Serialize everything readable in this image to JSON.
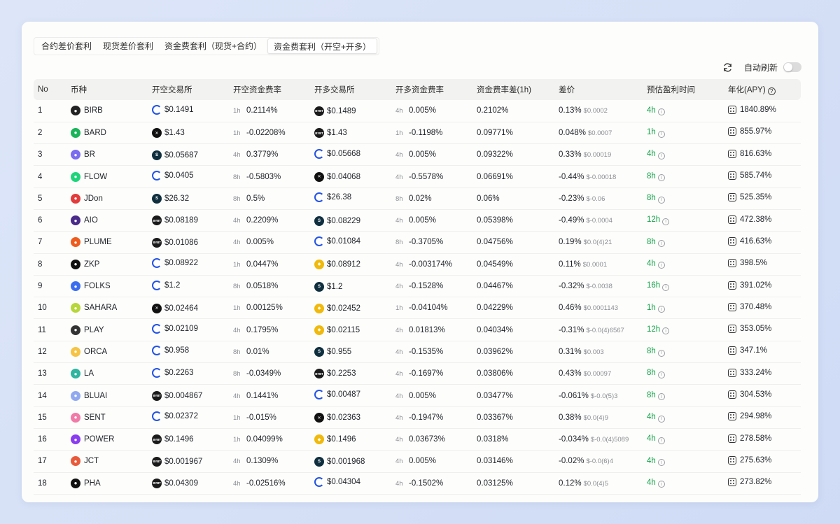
{
  "tabs": [
    {
      "label": "合约差价套利",
      "active": false
    },
    {
      "label": "现货差价套利",
      "active": false
    },
    {
      "label": "资金费套利（现货+合约）",
      "active": false
    },
    {
      "label": "资金费套利（开空+开多）",
      "active": true
    }
  ],
  "auto_refresh": {
    "label": "自动刷新",
    "enabled": false
  },
  "columns": [
    "No",
    "币种",
    "开空交易所",
    "开空资金费率",
    "开多交易所",
    "开多资金费率",
    "资金费率差(1h)",
    "差价",
    "预估盈利时间",
    "年化(APY)"
  ],
  "colors": {
    "profit_time": "#12a24a"
  },
  "rows": [
    {
      "no": "1",
      "coin": "BIRB",
      "coin_icon": "bird-icon",
      "coin_color": "#222222",
      "short_ex": "gate",
      "short_price": "$0.1491",
      "short_int": "1h",
      "short_rate": "0.2114%",
      "long_ex": "bybit",
      "long_price": "$0.1489",
      "long_int": "4h",
      "long_rate": "0.005%",
      "diff": "0.2102%",
      "spread": "0.13%",
      "spread_sub": "$0.0002",
      "time": "4h",
      "apy": "1840.89%"
    },
    {
      "no": "2",
      "coin": "BARD",
      "coin_icon": "bard-icon",
      "coin_color": "#19b35a",
      "short_ex": "okx",
      "short_price": "$1.43",
      "short_int": "1h",
      "short_rate": "-0.02208%",
      "long_ex": "bybit",
      "long_price": "$1.43",
      "long_int": "1h",
      "long_rate": "-0.1198%",
      "diff": "0.09771%",
      "spread": "0.048%",
      "spread_sub": "$0.0007",
      "time": "1h",
      "apy": "855.97%"
    },
    {
      "no": "3",
      "coin": "BR",
      "coin_icon": "layers-icon",
      "coin_color": "#7b6cf0",
      "short_ex": "bitget",
      "short_price": "$0.05687",
      "short_int": "4h",
      "short_rate": "0.3779%",
      "long_ex": "gate",
      "long_price": "$0.05668",
      "long_int": "4h",
      "long_rate": "0.005%",
      "diff": "0.09322%",
      "spread": "0.33%",
      "spread_sub": "$0.00019",
      "time": "4h",
      "apy": "816.63%"
    },
    {
      "no": "4",
      "coin": "FLOW",
      "coin_icon": "flow-icon",
      "coin_color": "#1ed47a",
      "short_ex": "gate",
      "short_price": "$0.0405",
      "short_int": "8h",
      "short_rate": "-0.5803%",
      "long_ex": "okx",
      "long_price": "$0.04068",
      "long_int": "4h",
      "long_rate": "-0.5578%",
      "diff": "0.06691%",
      "spread": "-0.44%",
      "spread_sub": "$-0.00018",
      "time": "8h",
      "apy": "585.74%"
    },
    {
      "no": "5",
      "coin": "JDon",
      "coin_icon": "jd-icon",
      "coin_color": "#e33b3b",
      "short_ex": "bitget",
      "short_price": "$26.32",
      "short_int": "8h",
      "short_rate": "0.5%",
      "long_ex": "gate",
      "long_price": "$26.38",
      "long_int": "8h",
      "long_rate": "0.02%",
      "diff": "0.06%",
      "spread": "-0.23%",
      "spread_sub": "$-0.06",
      "time": "8h",
      "apy": "525.35%"
    },
    {
      "no": "6",
      "coin": "AIO",
      "coin_icon": "aio-icon",
      "coin_color": "#4a2a8a",
      "short_ex": "bybit",
      "short_price": "$0.08189",
      "short_int": "4h",
      "short_rate": "0.2209%",
      "long_ex": "bitget",
      "long_price": "$0.08229",
      "long_int": "4h",
      "long_rate": "0.005%",
      "diff": "0.05398%",
      "spread": "-0.49%",
      "spread_sub": "$-0.0004",
      "time": "12h",
      "apy": "472.38%"
    },
    {
      "no": "7",
      "coin": "PLUME",
      "coin_icon": "plume-icon",
      "coin_color": "#ef5a1d",
      "short_ex": "bybit",
      "short_price": "$0.01086",
      "short_int": "4h",
      "short_rate": "0.005%",
      "long_ex": "gate",
      "long_price": "$0.01084",
      "long_int": "8h",
      "long_rate": "-0.3705%",
      "diff": "0.04756%",
      "spread": "0.19%",
      "spread_sub": "$0.0(4)21",
      "time": "8h",
      "apy": "416.63%"
    },
    {
      "no": "8",
      "coin": "ZKP",
      "coin_icon": "zkp-icon",
      "coin_color": "#111111",
      "short_ex": "gate",
      "short_price": "$0.08922",
      "short_int": "1h",
      "short_rate": "0.0447%",
      "long_ex": "binance",
      "long_price": "$0.08912",
      "long_int": "4h",
      "long_rate": "-0.003174%",
      "diff": "0.04549%",
      "spread": "0.11%",
      "spread_sub": "$0.0001",
      "time": "4h",
      "apy": "398.5%"
    },
    {
      "no": "9",
      "coin": "FOLKS",
      "coin_icon": "folks-icon",
      "coin_color": "#3a6ef0",
      "short_ex": "gate",
      "short_price": "$1.2",
      "short_int": "8h",
      "short_rate": "0.0518%",
      "long_ex": "bitget",
      "long_price": "$1.2",
      "long_int": "4h",
      "long_rate": "-0.1528%",
      "diff": "0.04467%",
      "spread": "-0.32%",
      "spread_sub": "$-0.0038",
      "time": "16h",
      "apy": "391.02%"
    },
    {
      "no": "10",
      "coin": "SAHARA",
      "coin_icon": "sahara-icon",
      "coin_color": "#b7d63a",
      "short_ex": "okx",
      "short_price": "$0.02464",
      "short_int": "1h",
      "short_rate": "0.00125%",
      "long_ex": "binance",
      "long_price": "$0.02452",
      "long_int": "1h",
      "long_rate": "-0.04104%",
      "diff": "0.04229%",
      "spread": "0.46%",
      "spread_sub": "$0.0001143",
      "time": "1h",
      "apy": "370.48%"
    },
    {
      "no": "11",
      "coin": "PLAY",
      "coin_icon": "play-icon",
      "coin_color": "#333333",
      "short_ex": "gate",
      "short_price": "$0.02109",
      "short_int": "4h",
      "short_rate": "0.1795%",
      "long_ex": "binance",
      "long_price": "$0.02115",
      "long_int": "4h",
      "long_rate": "0.01813%",
      "diff": "0.04034%",
      "spread": "-0.31%",
      "spread_sub": "$-0.0(4)6567",
      "time": "12h",
      "apy": "353.05%"
    },
    {
      "no": "12",
      "coin": "ORCA",
      "coin_icon": "orca-icon",
      "coin_color": "#f6c343",
      "short_ex": "gate",
      "short_price": "$0.958",
      "short_int": "8h",
      "short_rate": "0.01%",
      "long_ex": "bitget",
      "long_price": "$0.955",
      "long_int": "4h",
      "long_rate": "-0.1535%",
      "diff": "0.03962%",
      "spread": "0.31%",
      "spread_sub": "$0.003",
      "time": "8h",
      "apy": "347.1%"
    },
    {
      "no": "13",
      "coin": "LA",
      "coin_icon": "la-icon",
      "coin_color": "#2fb5a0",
      "short_ex": "gate",
      "short_price": "$0.2263",
      "short_int": "8h",
      "short_rate": "-0.0349%",
      "long_ex": "bybit",
      "long_price": "$0.2253",
      "long_int": "4h",
      "long_rate": "-0.1697%",
      "diff": "0.03806%",
      "spread": "0.43%",
      "spread_sub": "$0.00097",
      "time": "8h",
      "apy": "333.24%"
    },
    {
      "no": "14",
      "coin": "BLUAI",
      "coin_icon": "bluai-icon",
      "coin_color": "#8fa8f0",
      "short_ex": "bybit",
      "short_price": "$0.004867",
      "short_int": "4h",
      "short_rate": "0.1441%",
      "long_ex": "gate",
      "long_price": "$0.00487",
      "long_int": "4h",
      "long_rate": "0.005%",
      "diff": "0.03477%",
      "spread": "-0.061%",
      "spread_sub": "$-0.0(5)3",
      "time": "8h",
      "apy": "304.53%"
    },
    {
      "no": "15",
      "coin": "SENT",
      "coin_icon": "sent-icon",
      "coin_color": "#f07aa8",
      "short_ex": "gate",
      "short_price": "$0.02372",
      "short_int": "1h",
      "short_rate": "-0.015%",
      "long_ex": "okx",
      "long_price": "$0.02363",
      "long_int": "4h",
      "long_rate": "-0.1947%",
      "diff": "0.03367%",
      "spread": "0.38%",
      "spread_sub": "$0.0(4)9",
      "time": "4h",
      "apy": "294.98%"
    },
    {
      "no": "16",
      "coin": "POWER",
      "coin_icon": "power-icon",
      "coin_color": "#8a3df0",
      "short_ex": "bybit",
      "short_price": "$0.1496",
      "short_int": "1h",
      "short_rate": "0.04099%",
      "long_ex": "binance",
      "long_price": "$0.1496",
      "long_int": "4h",
      "long_rate": "0.03673%",
      "diff": "0.0318%",
      "spread": "-0.034%",
      "spread_sub": "$-0.0(4)5089",
      "time": "4h",
      "apy": "278.58%"
    },
    {
      "no": "17",
      "coin": "JCT",
      "coin_icon": "jct-icon",
      "coin_color": "#e85a3a",
      "short_ex": "bybit",
      "short_price": "$0.001967",
      "short_int": "4h",
      "short_rate": "0.1309%",
      "long_ex": "bitget",
      "long_price": "$0.001968",
      "long_int": "4h",
      "long_rate": "0.005%",
      "diff": "0.03146%",
      "spread": "-0.02%",
      "spread_sub": "$-0.0(6)4",
      "time": "4h",
      "apy": "275.63%"
    },
    {
      "no": "18",
      "coin": "PHA",
      "coin_icon": "pha-icon",
      "coin_color": "#111111",
      "short_ex": "bybit",
      "short_price": "$0.04309",
      "short_int": "4h",
      "short_rate": "-0.02516%",
      "long_ex": "gate",
      "long_price": "$0.04304",
      "long_int": "4h",
      "long_rate": "-0.1502%",
      "diff": "0.03125%",
      "spread": "0.12%",
      "spread_sub": "$0.0(4)5",
      "time": "4h",
      "apy": "273.82%"
    }
  ]
}
